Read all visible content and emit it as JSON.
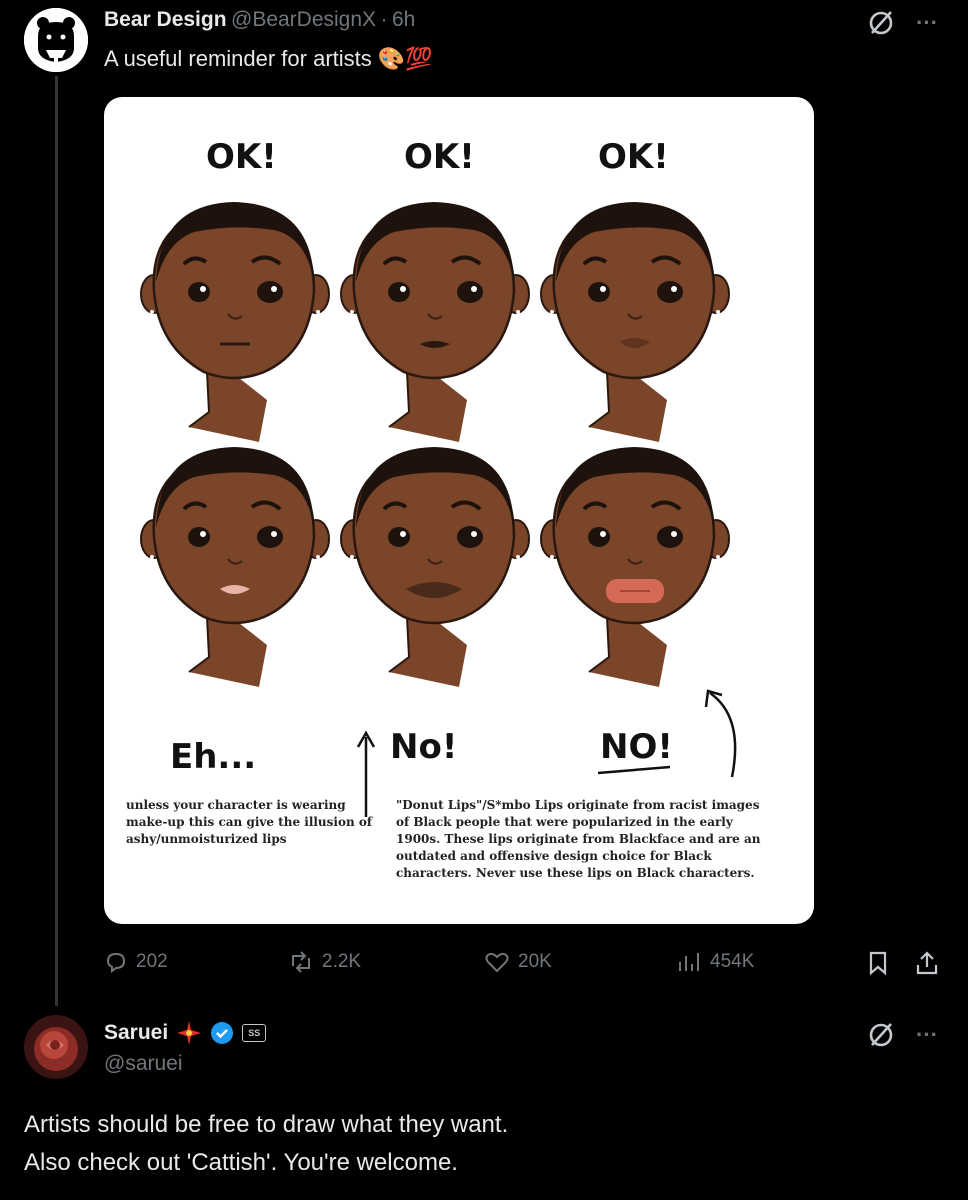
{
  "post": {
    "author_name": "Bear Design",
    "handle": "@BearDesignX",
    "separator": "·",
    "time": "6h",
    "text": "A useful reminder for artists",
    "emoji": "🎨💯"
  },
  "image": {
    "labels_top": [
      "OK!",
      "OK!",
      "OK!"
    ],
    "labels_bottom": [
      "Eh...",
      "No!",
      "NO!"
    ],
    "note_eh": "unless your character is wearing make-up this can give the illusion of ashy/unmoisturized lips",
    "note_no": "\"Donut Lips\"/S*mbo Lips originate from racist images of Black people that were popularized in the early 1900s. These lips originate from Blackface and are an outdated and offensive design choice for Black characters. Never use these lips on Black characters."
  },
  "actions": {
    "replies": "202",
    "reposts": "2.2K",
    "likes": "20K",
    "views": "454K"
  },
  "reply": {
    "author_name": "Saruei",
    "handle": "@saruei",
    "badge_text": "SS",
    "line1": "Artists should be free to draw what they want.",
    "line2": "Also check out 'Cattish'. You're welcome."
  },
  "colors": {
    "background": "#000000",
    "muted": "#71767b",
    "verified_blue": "#1d9bf0",
    "skin": "#7a4528",
    "hair": "#1e120d"
  },
  "icons": [
    "bear-avatar",
    "grok-icon",
    "more-icon",
    "reply-icon",
    "repost-icon",
    "like-icon",
    "views-icon",
    "bookmark-icon",
    "share-icon",
    "verified-icon",
    "sparkle-emoji"
  ]
}
